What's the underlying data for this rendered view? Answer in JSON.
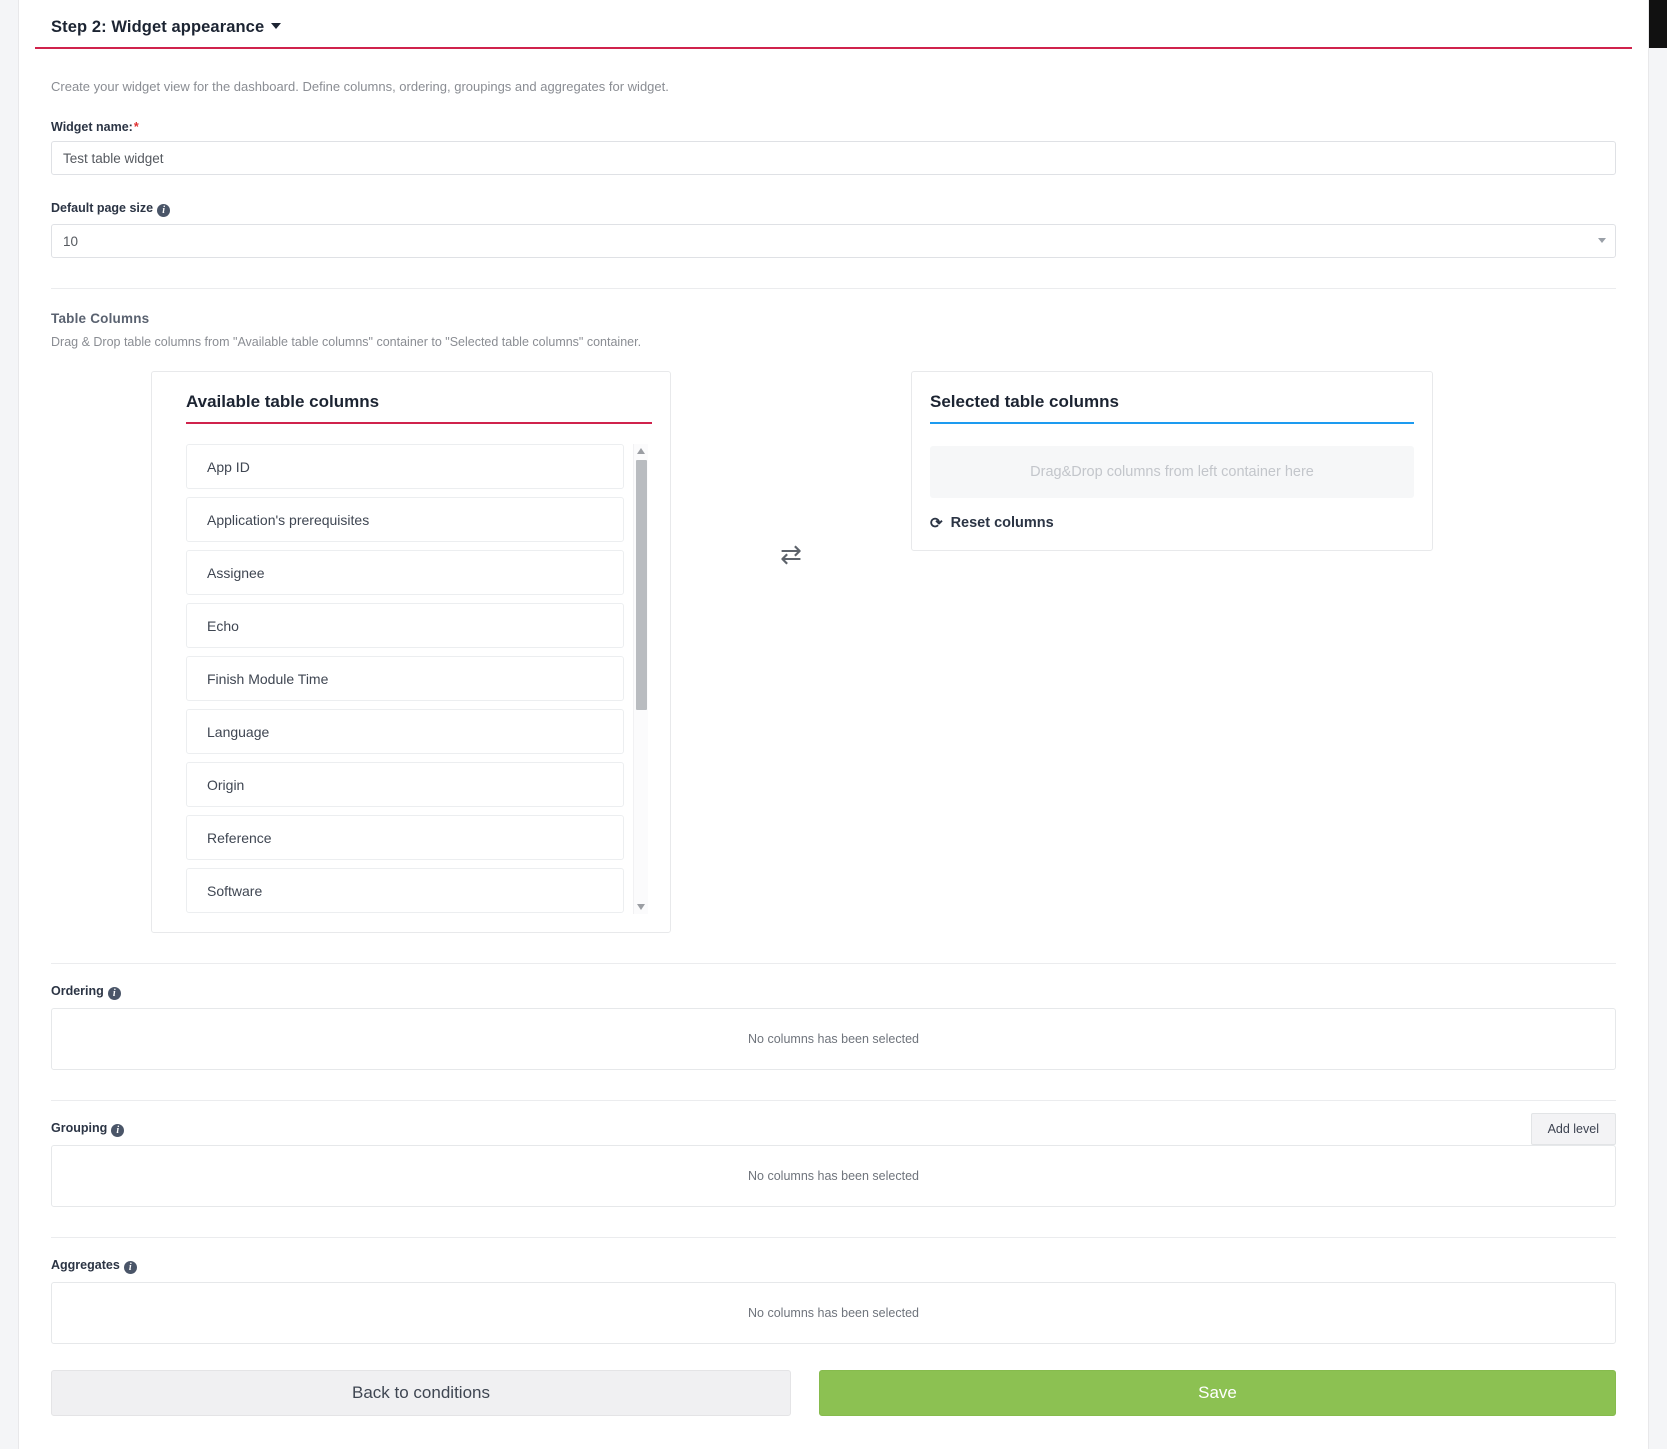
{
  "step": {
    "title": "Step 2: Widget appearance",
    "caret": "chevron-down-icon",
    "description": "Create your widget view for the dashboard. Define columns, ordering, groupings and aggregates for widget."
  },
  "form": {
    "widget_name_label": "Widget name:",
    "widget_name_required": "*",
    "widget_name_value": "Test table widget",
    "page_size_label": "Default page size",
    "page_size_value": "10"
  },
  "table_columns": {
    "heading": "Table Columns",
    "instruction": "Drag & Drop table columns from \"Available table columns\" container to \"Selected table columns\" container.",
    "available": {
      "title": "Available table columns",
      "items": [
        "App ID",
        "Application's prerequisites",
        "Assignee",
        "Echo",
        "Finish Module Time",
        "Language",
        "Origin",
        "Reference",
        "Software"
      ]
    },
    "exchange_icon": "⇄",
    "selected": {
      "title": "Selected table columns",
      "dropzone_placeholder": "Drag&Drop columns from left container here",
      "reset_label": "Reset columns",
      "reset_icon": "⟳"
    }
  },
  "ordering": {
    "label": "Ordering",
    "empty_text": "No columns has been selected"
  },
  "grouping": {
    "label": "Grouping",
    "empty_text": "No columns has been selected",
    "add_level_label": "Add level"
  },
  "aggregates": {
    "label": "Aggregates",
    "empty_text": "No columns has been selected"
  },
  "footer": {
    "back_label": "Back to conditions",
    "save_label": "Save"
  },
  "colors": {
    "accent_red": "#d0234c",
    "accent_blue": "#1d9bf0",
    "save_green": "#8cc152",
    "required_star": "#e03030"
  }
}
